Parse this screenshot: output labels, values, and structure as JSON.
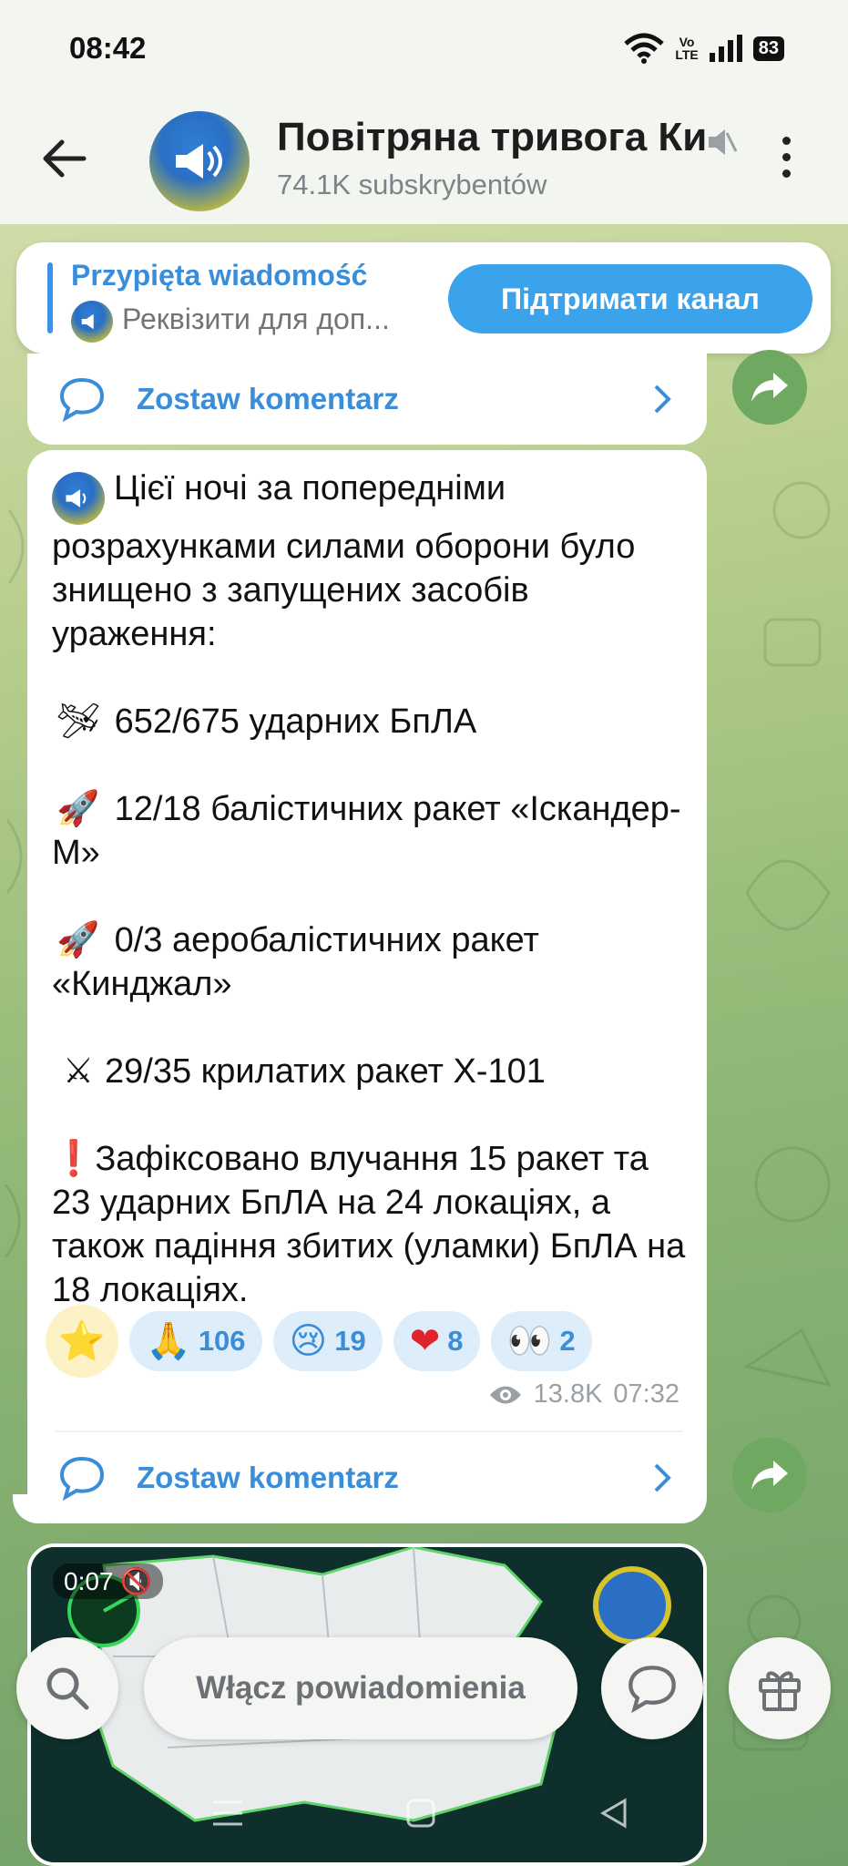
{
  "status": {
    "time": "08:42",
    "vo_top": "Vo",
    "vo_bottom": "LTE",
    "battery": "83"
  },
  "header": {
    "title": "Повітряна тривога Київ",
    "subscribers": "74.1K subskrybentów"
  },
  "pinned": {
    "title": "Przypięta wiadomość",
    "text": "Реквізити для доп...",
    "button": "Підтримати канал"
  },
  "comment_label": "Zostaw komentarz",
  "message": {
    "intro": "Цієї ночі за попередніми розрахунками силами оборони було знищено з запущених засобів ураження:",
    "drones": "652/675 ударних БпЛА",
    "ballistic": "12/18 балістичних ракет «Іскандер-М»",
    "aeroballistic": "0/3 аеробалістичних ракет «Кинджал»",
    "cruise": "29/35 крилатих ракет Х-101",
    "hits": "Зафіксовано влучання 15 ракет та 23 ударних БпЛА на 24 локаціях, а також падіння збитих (уламки) БпЛА на 18 локаціях.",
    "views": "13.8K",
    "time": "07:32"
  },
  "reactions": [
    {
      "emoji": "⭐",
      "count": ""
    },
    {
      "emoji": "🙏",
      "count": "106"
    },
    {
      "emoji": "😢",
      "count": "19"
    },
    {
      "emoji": "❤",
      "count": "8"
    },
    {
      "emoji": "👀",
      "count": "2"
    }
  ],
  "video": {
    "duration": "0:07"
  },
  "bottom": {
    "notify": "Włącz powiadomienia"
  },
  "colors": {
    "accent": "#3a8dd8",
    "button": "#3aa3ec",
    "share": "#6ea861"
  }
}
